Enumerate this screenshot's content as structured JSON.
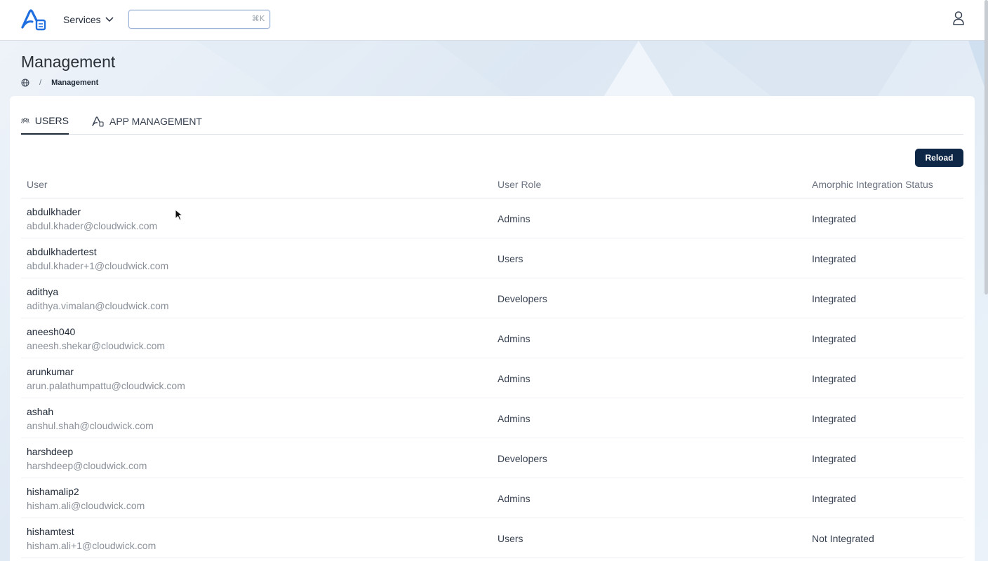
{
  "header": {
    "services_label": "Services",
    "search": {
      "value": "",
      "placeholder": "",
      "shortcut": "⌘K"
    },
    "user_icon": "user-icon"
  },
  "page": {
    "title": "Management",
    "breadcrumb": {
      "home_icon": "globe-icon",
      "separator": "/",
      "current": "Management"
    }
  },
  "tabs": [
    {
      "label": "USERS",
      "icon": "users-icon",
      "active": true
    },
    {
      "label": "APP MANAGEMENT",
      "icon": "app-icon",
      "active": false
    }
  ],
  "actions": {
    "reload_label": "Reload"
  },
  "table": {
    "columns": [
      "User",
      "User Role",
      "Amorphic Integration Status"
    ],
    "rows": [
      {
        "name": "abdulkhader",
        "email": "abdul.khader@cloudwick.com",
        "role": "Admins",
        "status": "Integrated"
      },
      {
        "name": "abdulkhadertest",
        "email": "abdul.khader+1@cloudwick.com",
        "role": "Users",
        "status": "Integrated"
      },
      {
        "name": "adithya",
        "email": "adithya.vimalan@cloudwick.com",
        "role": "Developers",
        "status": "Integrated"
      },
      {
        "name": "aneesh040",
        "email": "aneesh.shekar@cloudwick.com",
        "role": "Admins",
        "status": "Integrated"
      },
      {
        "name": "arunkumar",
        "email": "arun.palathumpattu@cloudwick.com",
        "role": "Admins",
        "status": "Integrated"
      },
      {
        "name": "ashah",
        "email": "anshul.shah@cloudwick.com",
        "role": "Admins",
        "status": "Integrated"
      },
      {
        "name": "harshdeep",
        "email": "harshdeep@cloudwick.com",
        "role": "Developers",
        "status": "Integrated"
      },
      {
        "name": "hishamalip2",
        "email": "hisham.ali@cloudwick.com",
        "role": "Admins",
        "status": "Integrated"
      },
      {
        "name": "hishamtest",
        "email": "hisham.ali+1@cloudwick.com",
        "role": "Users",
        "status": "Not Integrated"
      }
    ]
  },
  "colors": {
    "accent": "#0f2747",
    "link_border": "#9db4d8",
    "muted": "#8a9099"
  }
}
